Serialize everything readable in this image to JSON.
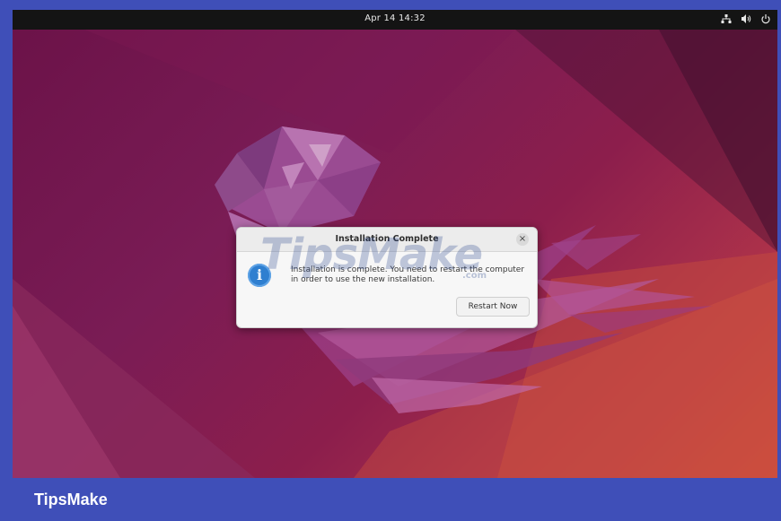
{
  "topbar": {
    "clock": "Apr 14  14:32",
    "icons": [
      "network-icon",
      "volume-icon",
      "power-icon"
    ]
  },
  "dialog": {
    "title": "Installation Complete",
    "close_glyph": "×",
    "icon": "info-icon",
    "icon_glyph": "i",
    "message_line1": "Installation is complete. You need to restart the computer",
    "message_line2": "in order to use the new installation.",
    "restart_label": "Restart Now"
  },
  "watermark": {
    "text": "TipsMake",
    "sub": ".com"
  },
  "branding": {
    "label": "TipsMake"
  },
  "colors": {
    "frame": "#3f4fb8",
    "topbar": "#141414",
    "wallpaper_start": "#6b1248",
    "wallpaper_end": "#cf4a3a",
    "info_blue": "#2f7fd0"
  }
}
